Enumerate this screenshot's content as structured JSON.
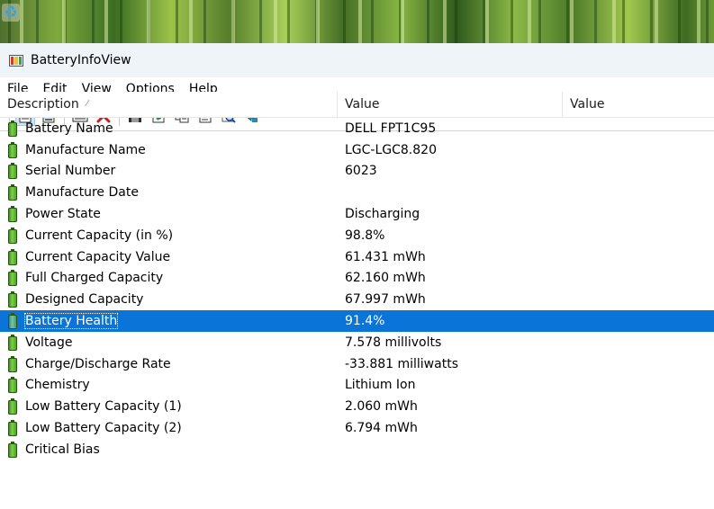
{
  "window": {
    "title": "BatteryInfoView"
  },
  "menu": [
    "File",
    "Edit",
    "View",
    "Options",
    "Help"
  ],
  "toolbar": {
    "buttons": [
      "simple-mode-icon",
      "advanced-mode-icon",
      "properties-view-icon",
      "delete-icon",
      "save-icon",
      "refresh-icon",
      "copy-icon",
      "properties-icon",
      "find-icon",
      "exit-icon"
    ]
  },
  "columns": {
    "description": "Description",
    "value": "Value",
    "value2": "Value"
  },
  "rows": [
    {
      "description": "Battery Name",
      "value": "DELL FPT1C95"
    },
    {
      "description": "Manufacture Name",
      "value": "LGC-LGC8.820"
    },
    {
      "description": "Serial Number",
      "value": "6023"
    },
    {
      "description": "Manufacture Date",
      "value": ""
    },
    {
      "description": "Power State",
      "value": "Discharging"
    },
    {
      "description": "Current Capacity (in %)",
      "value": "98.8%"
    },
    {
      "description": "Current Capacity Value",
      "value": "61.431 mWh"
    },
    {
      "description": "Full Charged Capacity",
      "value": "62.160 mWh"
    },
    {
      "description": "Designed Capacity",
      "value": "67.997 mWh"
    },
    {
      "description": "Battery Health",
      "value": "91.4%",
      "selected": true
    },
    {
      "description": "Voltage",
      "value": "7.578 millivolts"
    },
    {
      "description": "Charge/Discharge Rate",
      "value": "-33.881 milliwatts"
    },
    {
      "description": "Chemistry",
      "value": "Lithium Ion"
    },
    {
      "description": "Low Battery Capacity (1)",
      "value": "2.060 mWh"
    },
    {
      "description": "Low Battery Capacity (2)",
      "value": "6.794 mWh"
    },
    {
      "description": "Critical Bias",
      "value": ""
    }
  ],
  "colors": {
    "selection": "#0a74d8",
    "titlebar": "#eff4f9",
    "battery": "#3f9a1c"
  }
}
